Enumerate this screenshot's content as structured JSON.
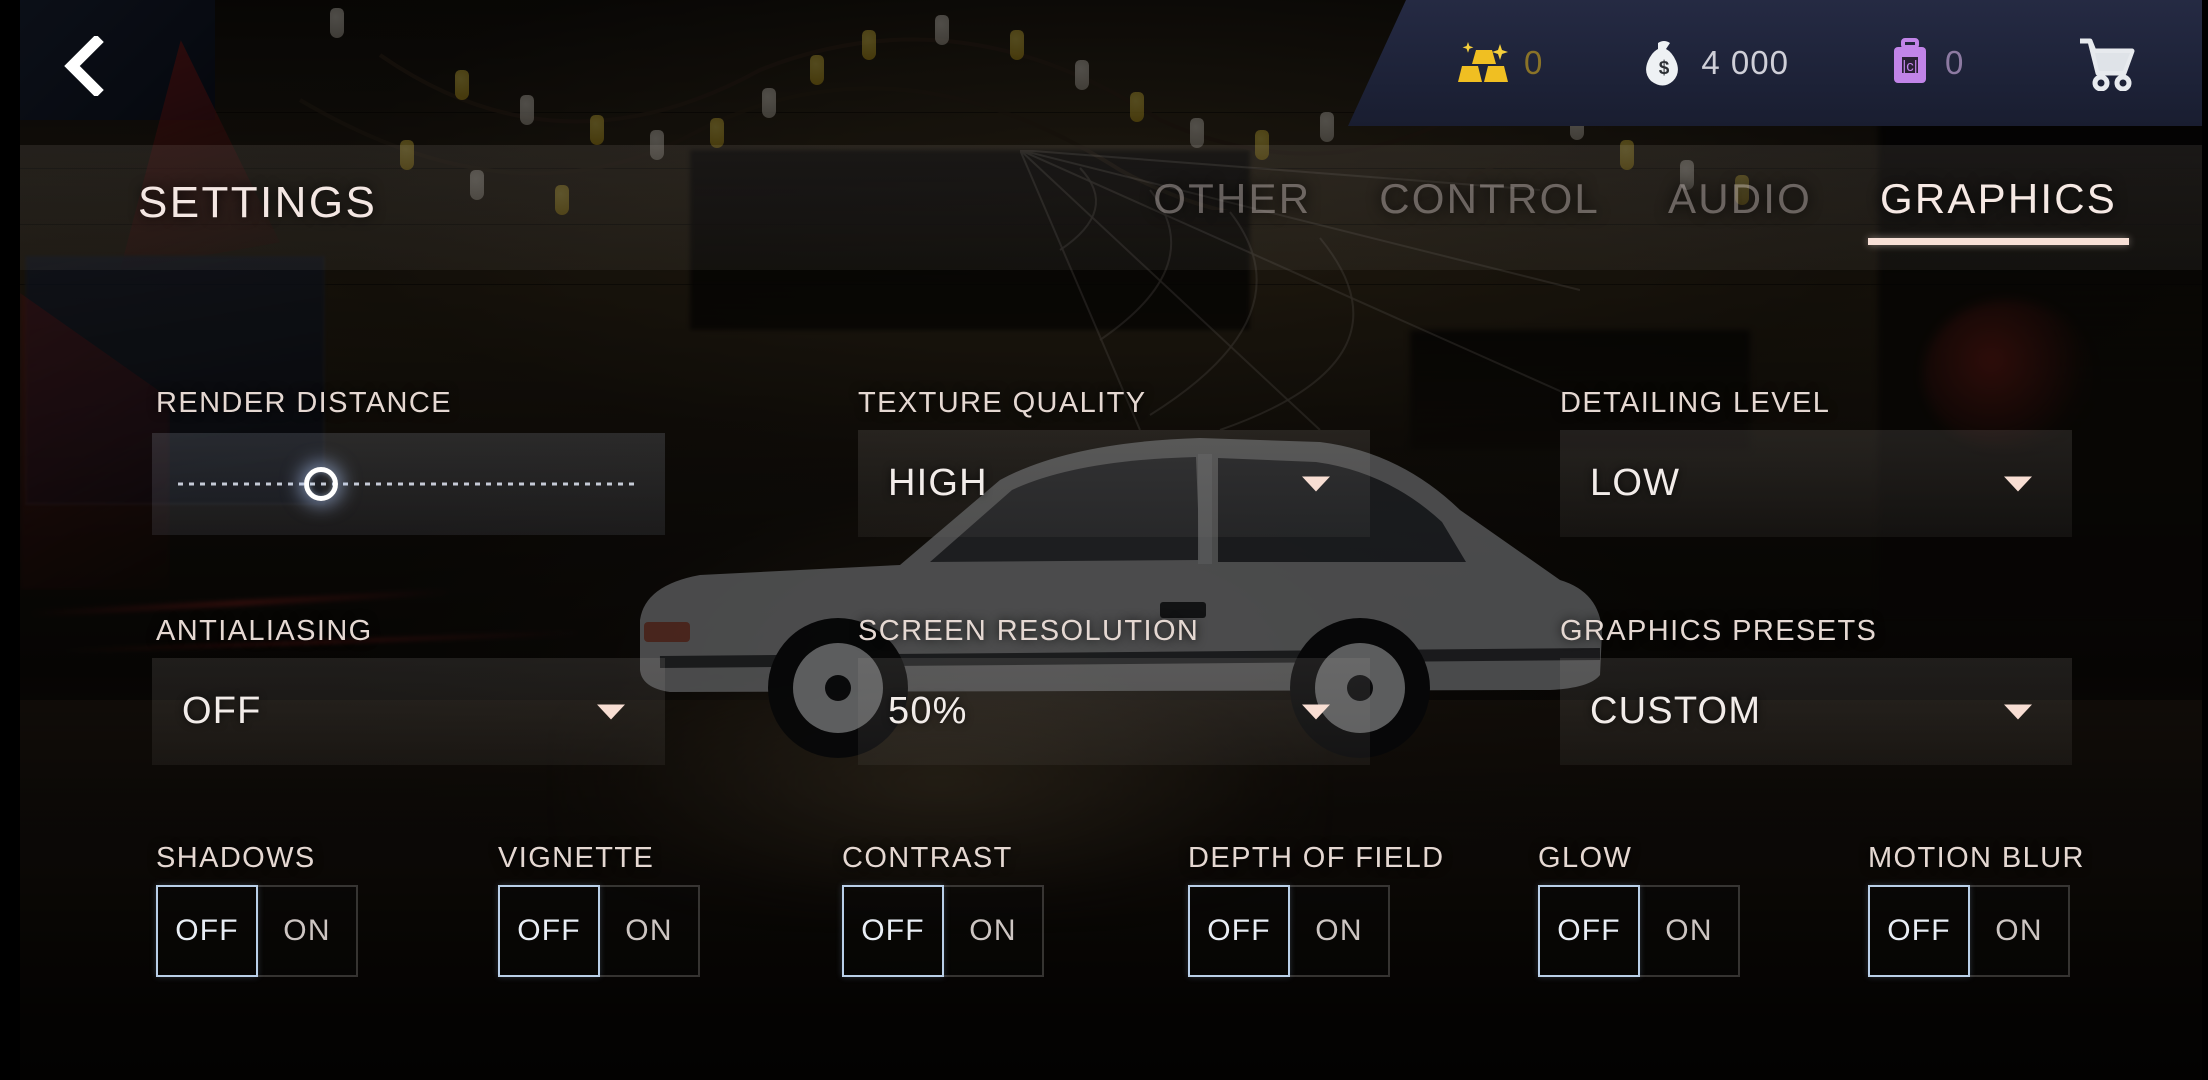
{
  "hud": {
    "items": [
      {
        "icon": "gold-bars-icon",
        "value": "0",
        "kind": "gold"
      },
      {
        "icon": "money-bag-icon",
        "value": "4 000",
        "kind": "money"
      },
      {
        "icon": "briefcase-icon",
        "value": "0",
        "kind": "case"
      }
    ],
    "cart_icon": "shopping-cart-icon"
  },
  "nav": {
    "back_icon": "back-chevron-icon"
  },
  "header": {
    "title": "SETTINGS",
    "tabs": [
      {
        "label": "OTHER",
        "active": false
      },
      {
        "label": "CONTROL",
        "active": false
      },
      {
        "label": "AUDIO",
        "active": false
      },
      {
        "label": "GRAPHICS",
        "active": true
      }
    ],
    "active_underline_color": "#f7dfd6"
  },
  "settings": {
    "render_distance": {
      "label": "RENDER DISTANCE",
      "value_percent": 31
    },
    "texture_quality": {
      "label": "TEXTURE QUALITY",
      "value": "HIGH"
    },
    "detailing_level": {
      "label": "DETAILING LEVEL",
      "value": "LOW"
    },
    "antialiasing": {
      "label": "ANTIALIASING",
      "value": "OFF"
    },
    "screen_resolution": {
      "label": "SCREEN RESOLUTION",
      "value": "50%"
    },
    "graphics_presets": {
      "label": "GRAPHICS PRESETS",
      "value": "CUSTOM"
    },
    "toggles": [
      {
        "label": "SHADOWS",
        "off": "OFF",
        "on": "ON",
        "selected": "OFF"
      },
      {
        "label": "VIGNETTE",
        "off": "OFF",
        "on": "ON",
        "selected": "OFF"
      },
      {
        "label": "CONTRAST",
        "off": "OFF",
        "on": "ON",
        "selected": "OFF"
      },
      {
        "label": "DEPTH OF FIELD",
        "off": "OFF",
        "on": "ON",
        "selected": "OFF"
      },
      {
        "label": "GLOW",
        "off": "OFF",
        "on": "ON",
        "selected": "OFF"
      },
      {
        "label": "MOTION BLUR",
        "off": "OFF",
        "on": "ON",
        "selected": "OFF"
      }
    ]
  }
}
